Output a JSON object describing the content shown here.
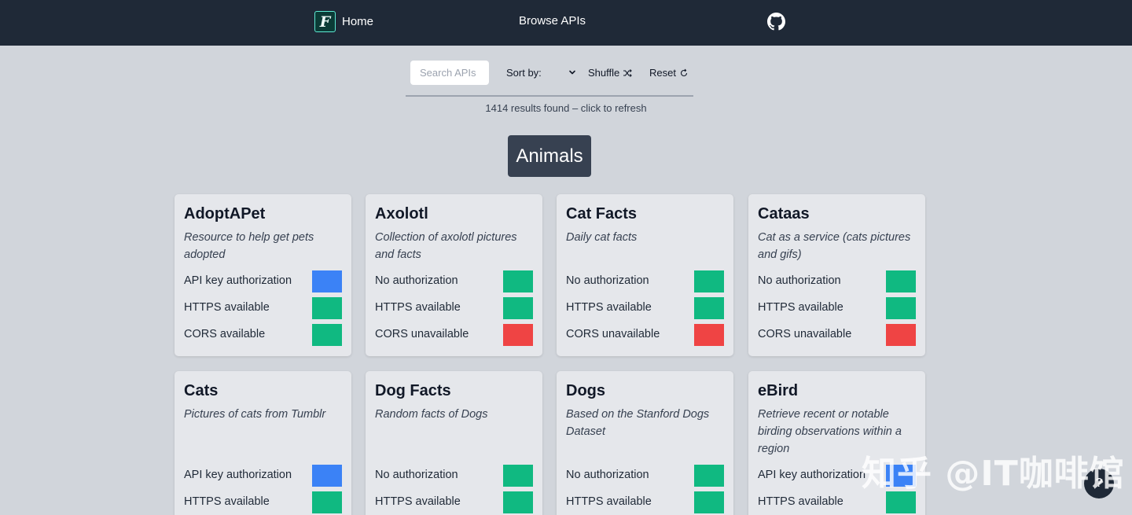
{
  "nav": {
    "logo_letter": "F",
    "home_label": "Home",
    "browse_label": "Browse APIs"
  },
  "toolbar": {
    "search_placeholder": "Search APIs",
    "sort_label": "Sort by:",
    "shuffle_label": "Shuffle",
    "reset_label": "Reset"
  },
  "results_text": "1414 results found – click to refresh",
  "category": "Animals",
  "colors": {
    "auth_key": "#3b82f6",
    "available": "#10b981",
    "unavailable": "#ef4444"
  },
  "cards": [
    {
      "name": "AdoptAPet",
      "description": "Resource to help get pets adopted",
      "attrs": [
        {
          "label": "API key authorization",
          "status": "key"
        },
        {
          "label": "HTTPS available",
          "status": "ok"
        },
        {
          "label": "CORS available",
          "status": "ok"
        }
      ]
    },
    {
      "name": "Axolotl",
      "description": "Collection of axolotl pictures and facts",
      "attrs": [
        {
          "label": "No authorization",
          "status": "ok"
        },
        {
          "label": "HTTPS available",
          "status": "ok"
        },
        {
          "label": "CORS unavailable",
          "status": "bad"
        }
      ]
    },
    {
      "name": "Cat Facts",
      "description": "Daily cat facts",
      "attrs": [
        {
          "label": "No authorization",
          "status": "ok"
        },
        {
          "label": "HTTPS available",
          "status": "ok"
        },
        {
          "label": "CORS unavailable",
          "status": "bad"
        }
      ]
    },
    {
      "name": "Cataas",
      "description": "Cat as a service (cats pictures and gifs)",
      "attrs": [
        {
          "label": "No authorization",
          "status": "ok"
        },
        {
          "label": "HTTPS available",
          "status": "ok"
        },
        {
          "label": "CORS unavailable",
          "status": "bad"
        }
      ]
    },
    {
      "name": "Cats",
      "description": "Pictures of cats from Tumblr",
      "attrs": [
        {
          "label": "API key authorization",
          "status": "key"
        },
        {
          "label": "HTTPS available",
          "status": "ok"
        }
      ]
    },
    {
      "name": "Dog Facts",
      "description": "Random facts of Dogs",
      "attrs": [
        {
          "label": "No authorization",
          "status": "ok"
        },
        {
          "label": "HTTPS available",
          "status": "ok"
        }
      ]
    },
    {
      "name": "Dogs",
      "description": "Based on the Stanford Dogs Dataset",
      "attrs": [
        {
          "label": "No authorization",
          "status": "ok"
        },
        {
          "label": "HTTPS available",
          "status": "ok"
        }
      ]
    },
    {
      "name": "eBird",
      "description": "Retrieve recent or notable birding observations within a region",
      "attrs": [
        {
          "label": "API key authorization",
          "status": "key"
        },
        {
          "label": "HTTPS available",
          "status": "ok"
        }
      ]
    }
  ],
  "help_label": "?",
  "watermark": "知乎 @IT咖啡馆"
}
